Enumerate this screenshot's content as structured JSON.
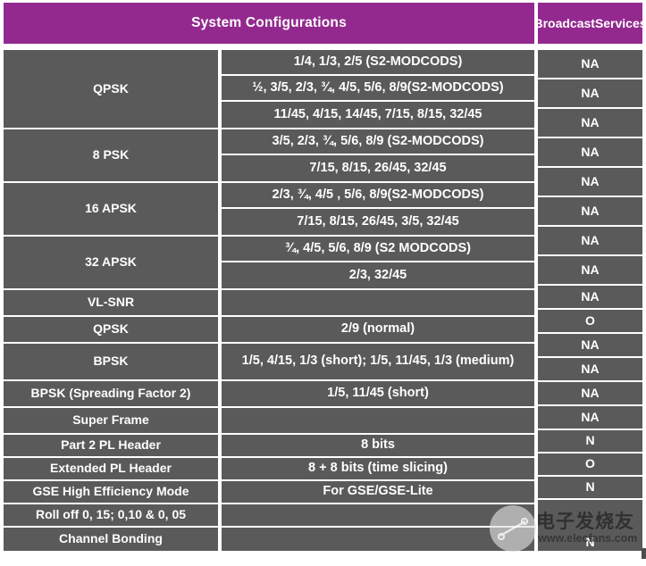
{
  "header": {
    "main_title": "System Configurations",
    "side_title_line1": "Broadcast",
    "side_title_line2": "Services",
    "accent_color": "#93298f",
    "cell_color": "#5a5a5a",
    "text_color": "#ffffff"
  },
  "columns": {
    "modulation": "System Configurations",
    "coderates": "",
    "broadcast": "Broadcast Services"
  },
  "left_cells": [
    {
      "label": "QPSK",
      "span": 3
    },
    {
      "label": "8 PSK",
      "span": 2
    },
    {
      "label": "16 APSK",
      "span": 2
    },
    {
      "label": "32 APSK",
      "span": 2
    },
    {
      "label": "VL-SNR",
      "span": 1
    },
    {
      "label": "QPSK",
      "span": 1
    },
    {
      "label": "BPSK",
      "span": 1
    },
    {
      "label": "BPSK (Spreading Factor 2)",
      "span": 1
    },
    {
      "label": "Super Frame",
      "span": 1
    },
    {
      "label": "Part 2 PL Header",
      "span": 1
    },
    {
      "label": "Extended PL Header",
      "span": 1
    },
    {
      "label": "GSE High Efficiency Mode",
      "span": 1
    },
    {
      "label": "Roll off 0, 15; 0,10 & 0, 05",
      "span": 1
    },
    {
      "label": "Channel Bonding",
      "span": 1
    }
  ],
  "mid_cells": [
    "1/4, 1/3, 2/5 (S2-MODCODS)",
    "½, 3/5, 2/3, ¾, 4/5, 5/6, 8/9(S2-MODCODS)",
    "11/45, 4/15, 14/45, 7/15, 8/15, 32/45",
    "3/5, 2/3, ¾, 5/6, 8/9 (S2-MODCODS)",
    "7/15, 8/15, 26/45, 32/45",
    "2/3, ¾, 4/5 , 5/6, 8/9(S2-MODCODS)",
    "7/15, 8/15, 26/45, 3/5, 32/45",
    "¾, 4/5, 5/6, 8/9 (S2 MODCODS)",
    "2/3, 32/45",
    "",
    "2/9 (normal)",
    "1/5, 4/15, 1/3 (short); 1/5, 11/45, 1/3 (medium)",
    "1/5, 11/45 (short)",
    "",
    "8 bits",
    "8 + 8 bits (time slicing)",
    "For GSE/GSE-Lite",
    "",
    ""
  ],
  "right_cells": [
    "NA",
    "NA",
    "NA",
    "NA",
    "NA",
    "NA",
    "NA",
    "NA",
    "NA",
    "O",
    "NA",
    "NA",
    "NA",
    "NA",
    "N",
    "O",
    "N",
    "N"
  ],
  "watermark": {
    "chinese": "电子发烧友",
    "url": "www.elecfans.com"
  }
}
